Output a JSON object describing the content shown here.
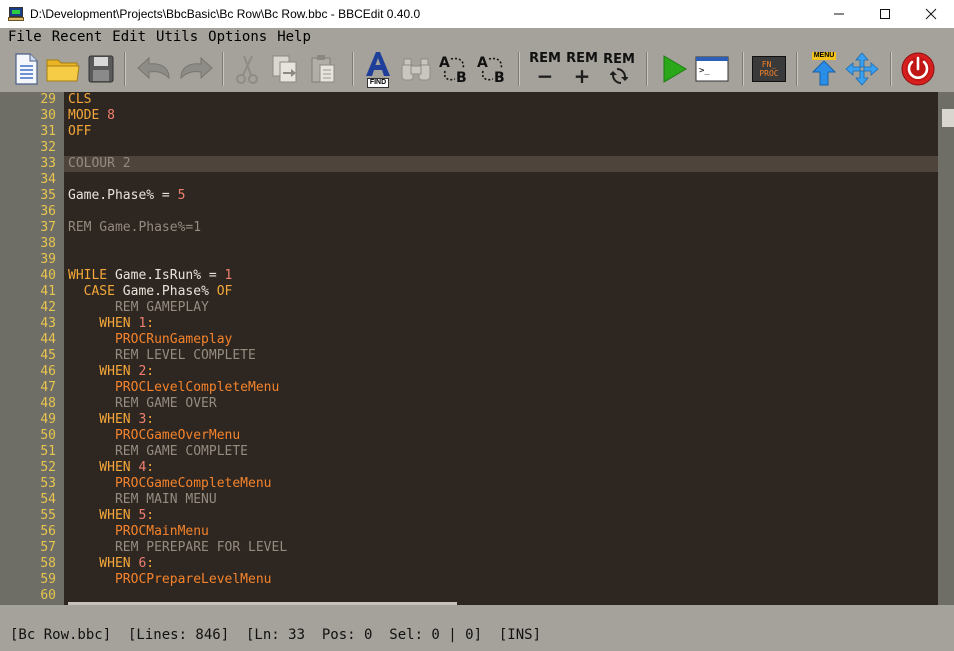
{
  "window": {
    "title": "D:\\Development\\Projects\\BbcBasic\\Bc Row\\Bc Row.bbc - BBCEdit 0.40.0"
  },
  "menu": [
    "File",
    "Recent",
    "Edit",
    "Utils",
    "Options",
    "Help"
  ],
  "toolbar": {
    "find_label": "FIND",
    "rem1": "REM",
    "rem2": "REM",
    "rem3": "REM",
    "fnproc_line1": "FN_",
    "fnproc_line2": "PROC",
    "menu_label": "MENU",
    "accent_green": "#2aa81a",
    "accent_blue": "#2a8de8",
    "accent_red": "#d81f1f"
  },
  "editor": {
    "highlight_line": "33",
    "lines": [
      {
        "num": "29",
        "segs": [
          {
            "t": "CLS",
            "c": "kw"
          }
        ]
      },
      {
        "num": "30",
        "segs": [
          {
            "t": "MODE ",
            "c": "kw"
          },
          {
            "t": "8",
            "c": "num"
          }
        ]
      },
      {
        "num": "31",
        "segs": [
          {
            "t": "OFF",
            "c": "kw"
          }
        ]
      },
      {
        "num": "32",
        "segs": []
      },
      {
        "num": "33",
        "segs": [
          {
            "t": "COLOUR ",
            "c": "rem"
          },
          {
            "t": "2",
            "c": "rem"
          }
        ]
      },
      {
        "num": "34",
        "segs": []
      },
      {
        "num": "35",
        "segs": [
          {
            "t": "Game.Phase% = ",
            "c": "plain"
          },
          {
            "t": "5",
            "c": "num"
          }
        ]
      },
      {
        "num": "36",
        "segs": []
      },
      {
        "num": "37",
        "segs": [
          {
            "t": "REM Game.Phase%=1",
            "c": "remline"
          }
        ]
      },
      {
        "num": "38",
        "segs": []
      },
      {
        "num": "39",
        "segs": []
      },
      {
        "num": "40",
        "segs": [
          {
            "t": "WHILE ",
            "c": "kw"
          },
          {
            "t": "Game.IsRun% = ",
            "c": "plain"
          },
          {
            "t": "1",
            "c": "num"
          }
        ]
      },
      {
        "num": "41",
        "segs": [
          {
            "t": "  CASE ",
            "c": "kw"
          },
          {
            "t": "Game.Phase% ",
            "c": "plain"
          },
          {
            "t": "OF",
            "c": "kw"
          }
        ]
      },
      {
        "num": "42",
        "segs": [
          {
            "t": "      REM GAMEPLAY",
            "c": "remline"
          }
        ]
      },
      {
        "num": "43",
        "segs": [
          {
            "t": "    WHEN ",
            "c": "kw"
          },
          {
            "t": "1",
            "c": "num"
          },
          {
            "t": ":",
            "c": "kw"
          }
        ]
      },
      {
        "num": "44",
        "segs": [
          {
            "t": "      PROCRunGameplay",
            "c": "proc"
          }
        ]
      },
      {
        "num": "45",
        "segs": [
          {
            "t": "      REM LEVEL COMPLETE",
            "c": "remline"
          }
        ]
      },
      {
        "num": "46",
        "segs": [
          {
            "t": "    WHEN ",
            "c": "kw"
          },
          {
            "t": "2",
            "c": "num"
          },
          {
            "t": ":",
            "c": "kw"
          }
        ]
      },
      {
        "num": "47",
        "segs": [
          {
            "t": "      PROCLevelCompleteMenu",
            "c": "proc"
          }
        ]
      },
      {
        "num": "48",
        "segs": [
          {
            "t": "      REM GAME OVER",
            "c": "remline"
          }
        ]
      },
      {
        "num": "49",
        "segs": [
          {
            "t": "    WHEN ",
            "c": "kw"
          },
          {
            "t": "3",
            "c": "num"
          },
          {
            "t": ":",
            "c": "kw"
          }
        ]
      },
      {
        "num": "50",
        "segs": [
          {
            "t": "      PROCGameOverMenu",
            "c": "proc"
          }
        ]
      },
      {
        "num": "51",
        "segs": [
          {
            "t": "      REM GAME COMPLETE",
            "c": "remline"
          }
        ]
      },
      {
        "num": "52",
        "segs": [
          {
            "t": "    WHEN ",
            "c": "kw"
          },
          {
            "t": "4",
            "c": "num"
          },
          {
            "t": ":",
            "c": "kw"
          }
        ]
      },
      {
        "num": "53",
        "segs": [
          {
            "t": "      PROCGameCompleteMenu",
            "c": "proc"
          }
        ]
      },
      {
        "num": "54",
        "segs": [
          {
            "t": "      REM MAIN MENU",
            "c": "remline"
          }
        ]
      },
      {
        "num": "55",
        "segs": [
          {
            "t": "    WHEN ",
            "c": "kw"
          },
          {
            "t": "5",
            "c": "num"
          },
          {
            "t": ":",
            "c": "kw"
          }
        ]
      },
      {
        "num": "56",
        "segs": [
          {
            "t": "      PROCMainMenu",
            "c": "proc"
          }
        ]
      },
      {
        "num": "57",
        "segs": [
          {
            "t": "      REM PEREPARE FOR LEVEL",
            "c": "remline"
          }
        ]
      },
      {
        "num": "58",
        "segs": [
          {
            "t": "    WHEN ",
            "c": "kw"
          },
          {
            "t": "6",
            "c": "num"
          },
          {
            "t": ":",
            "c": "kw"
          }
        ]
      },
      {
        "num": "59",
        "segs": [
          {
            "t": "      PROCPrepareLevelMenu",
            "c": "proc"
          }
        ]
      },
      {
        "num": "60",
        "segs": []
      }
    ]
  },
  "status": {
    "text": "[Bc Row.bbc]  [Lines: 846]  [Ln: 33  Pos: 0  Sel: 0 | 0]  [INS]"
  }
}
